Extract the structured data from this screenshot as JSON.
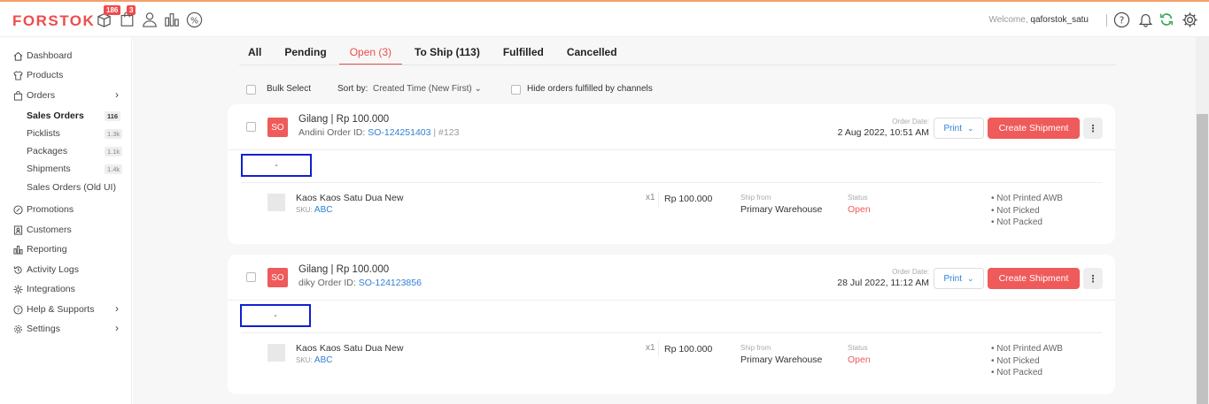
{
  "header": {
    "logo": "FORSTOK",
    "badge_a": "186",
    "badge_b": "3",
    "welcome_prefix": "Welcome,",
    "username": "qaforstok_satu",
    "icons": [
      "box-icon",
      "bag-icon",
      "user-icon",
      "bar-chart-icon",
      "percent-icon",
      "help-icon",
      "bell-icon",
      "sync-icon",
      "gear-icon"
    ]
  },
  "sidebar": {
    "items": [
      {
        "label": "Dashboard",
        "icon": "home-icon"
      },
      {
        "label": "Products",
        "icon": "shirt-icon"
      },
      {
        "label": "Orders",
        "icon": "bag-icon"
      },
      {
        "label": "Promotions",
        "icon": "promo-icon"
      },
      {
        "label": "Customers",
        "icon": "contact-icon"
      },
      {
        "label": "Reporting",
        "icon": "chart-icon"
      },
      {
        "label": "Activity Logs",
        "icon": "history-icon"
      },
      {
        "label": "Integrations",
        "icon": "integration-icon"
      },
      {
        "label": "Help & Supports",
        "icon": "help-icon"
      },
      {
        "label": "Settings",
        "icon": "gear-icon"
      }
    ],
    "sub_items": [
      {
        "label": "Sales Orders",
        "count": "116"
      },
      {
        "label": "Picklists",
        "count": "1.3k"
      },
      {
        "label": "Packages",
        "count": "1.1k"
      },
      {
        "label": "Shipments",
        "count": "1.4k"
      },
      {
        "label": "Sales Orders (Old UI)",
        "count": ""
      }
    ]
  },
  "tabs": [
    "All",
    "Pending",
    "Open (3)",
    "To Ship (113)",
    "Fulfilled",
    "Cancelled"
  ],
  "filters": {
    "bulk_select": "Bulk Select",
    "sort_label": "Sort by:",
    "sort_value": "Created Time (New First)",
    "hide_label": "Hide orders fulfilled by channels"
  },
  "orders": [
    {
      "badge": "SO",
      "customer": "Gilang",
      "sep": "|",
      "total": "Rp 100.000",
      "name": "Andini",
      "order_id_label": "Order ID:",
      "order_id": "SO-124251403",
      "ref_sep": "|",
      "ref": "#123",
      "date_label": "Order Date:",
      "date": "2 Aug 2022, 10:51 AM",
      "print": "Print",
      "create": "Create Shipment",
      "note": "-",
      "product": "Kaos Kaos Satu Dua New",
      "sku_label": "SKU:",
      "sku": "ABC",
      "qty": "x1",
      "price": "Rp 100.000",
      "ship_from_label": "Ship from",
      "ship_from": "Primary Warehouse",
      "status_label": "Status",
      "status": "Open",
      "flags": [
        "• Not Printed AWB",
        "• Not Picked",
        "• Not Packed"
      ]
    },
    {
      "badge": "SO",
      "customer": "Gilang",
      "sep": "|",
      "total": "Rp 100.000",
      "name": "diky",
      "order_id_label": "Order ID:",
      "order_id": "SO-124123856",
      "ref_sep": "",
      "ref": "",
      "date_label": "Order Date:",
      "date": "28 Jul 2022, 11:12 AM",
      "print": "Print",
      "create": "Create Shipment",
      "note": "-",
      "product": "Kaos Kaos Satu Dua New",
      "sku_label": "SKU:",
      "sku": "ABC",
      "qty": "x1",
      "price": "Rp 100.000",
      "ship_from_label": "Ship from",
      "ship_from": "Primary Warehouse",
      "status_label": "Status",
      "status": "Open",
      "flags": [
        "• Not Printed AWB",
        "• Not Picked",
        "• Not Packed"
      ]
    }
  ],
  "colors": {
    "accent": "#ef4c4c",
    "link": "#2f7fd4",
    "highlight_box": "#1020d0"
  }
}
